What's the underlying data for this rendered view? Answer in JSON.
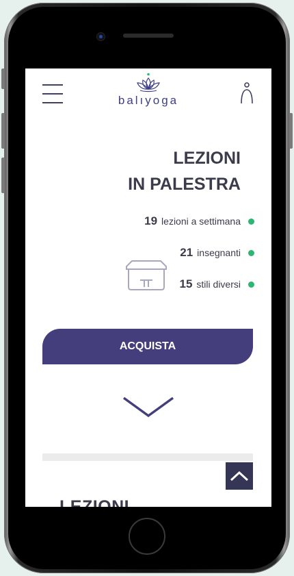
{
  "header": {
    "logo_text": "balıyoga",
    "menu_icon": "hamburger-menu-icon",
    "user_icon": "user-icon",
    "logo_icon": "lotus-icon"
  },
  "hero": {
    "title_line1": "LEZIONI",
    "title_line2": "IN PALESTRA",
    "stats": [
      {
        "number": "19",
        "label": "lezioni a settimana"
      },
      {
        "number": "21",
        "label": "insegnanti"
      },
      {
        "number": "15",
        "label": "stili diversi"
      }
    ],
    "illustration_icon": "treatment-table-icon",
    "buy_label": "ACQUISTA"
  },
  "next_section": {
    "title": "LEZIONI"
  },
  "controls": {
    "scroll_down_icon": "chevron-down-icon",
    "scroll_top_icon": "chevron-up-icon"
  },
  "colors": {
    "accent": "#443f7c",
    "logo": "#3d3f85",
    "status_dot": "#2bb673",
    "text": "#3b3b4b",
    "background": "#e6f1ee"
  }
}
